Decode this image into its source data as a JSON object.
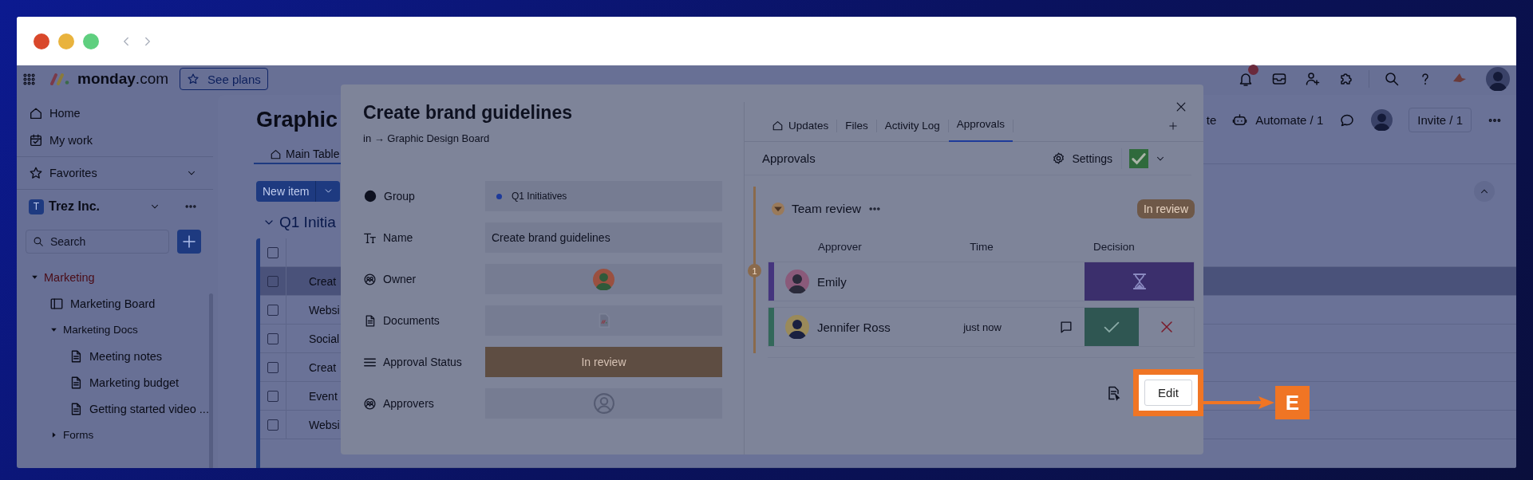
{
  "topbar": {
    "logo": "**monday**.com",
    "plans_button": "See plans"
  },
  "sidebar": {
    "nav": [
      {
        "label": "Home",
        "kind": "home"
      },
      {
        "label": "My work",
        "kind": "work"
      }
    ],
    "favorites": "Favorites",
    "workspace": {
      "initial": "T",
      "name": "Trez Inc."
    },
    "search": {
      "placeholder": "Search"
    },
    "tree": [
      {
        "label": "Marketing",
        "kind": "folder",
        "expanded": true,
        "children": [
          {
            "label": "Marketing Board",
            "kind": "board"
          },
          {
            "label": "Marketing Docs",
            "kind": "folder",
            "expanded": true,
            "children": [
              {
                "label": "Meeting notes",
                "kind": "doc"
              },
              {
                "label": "Marketing budget",
                "kind": "doc"
              },
              {
                "label": "Getting started video ...",
                "kind": "doc"
              }
            ]
          },
          {
            "label": "Forms",
            "kind": "folder",
            "expanded": false
          }
        ]
      }
    ]
  },
  "board": {
    "title": "Graphic",
    "tab": "Main Table",
    "new_item": "New item",
    "toolbar": [
      "te",
      "Automate / 1"
    ],
    "invite": "Invite / 1",
    "group": "Q1 Initia",
    "select_all_checked": false,
    "rows": [
      {
        "name": "Creat",
        "selected": true,
        "checked": false
      },
      {
        "name": "Websi",
        "selected": false,
        "checked": false
      },
      {
        "name": "Social",
        "selected": false,
        "checked": false
      },
      {
        "name": "Creat",
        "selected": false,
        "checked": false
      },
      {
        "name": "Event",
        "selected": false,
        "checked": false
      },
      {
        "name": "Websi",
        "selected": false,
        "checked": false
      }
    ]
  },
  "item": {
    "title": "Create brand guidelines",
    "breadcrumb": "in → Graphic Design Board",
    "fields": [
      {
        "kind": "group",
        "label": "Group",
        "value": "Q1 Initiatives"
      },
      {
        "kind": "text",
        "label": "Name",
        "value": "Create brand guidelines"
      },
      {
        "kind": "person",
        "label": "Owner"
      },
      {
        "kind": "file",
        "label": "Documents"
      },
      {
        "kind": "status",
        "label": "Approval Status",
        "value": "In review"
      },
      {
        "kind": "people",
        "label": "Approvers"
      }
    ],
    "tabs": [
      {
        "label": "Updates",
        "selected": false
      },
      {
        "label": "Files",
        "selected": false
      },
      {
        "label": "Activity Log",
        "selected": false
      },
      {
        "label": "Approvals",
        "selected": true
      }
    ],
    "panel_title": "Approvals",
    "settings": "Settings",
    "stage": {
      "step": "1",
      "title": "Team review",
      "status": "In review",
      "columns": [
        "Approver",
        "Time",
        "Decision"
      ],
      "approvers": [
        {
          "name": "Emily",
          "kind": "pending"
        },
        {
          "name": "Jennifer Ross",
          "time": "just now",
          "kind": "approved"
        }
      ]
    },
    "edit_button": "Edit"
  },
  "annotation": {
    "label": "E"
  }
}
